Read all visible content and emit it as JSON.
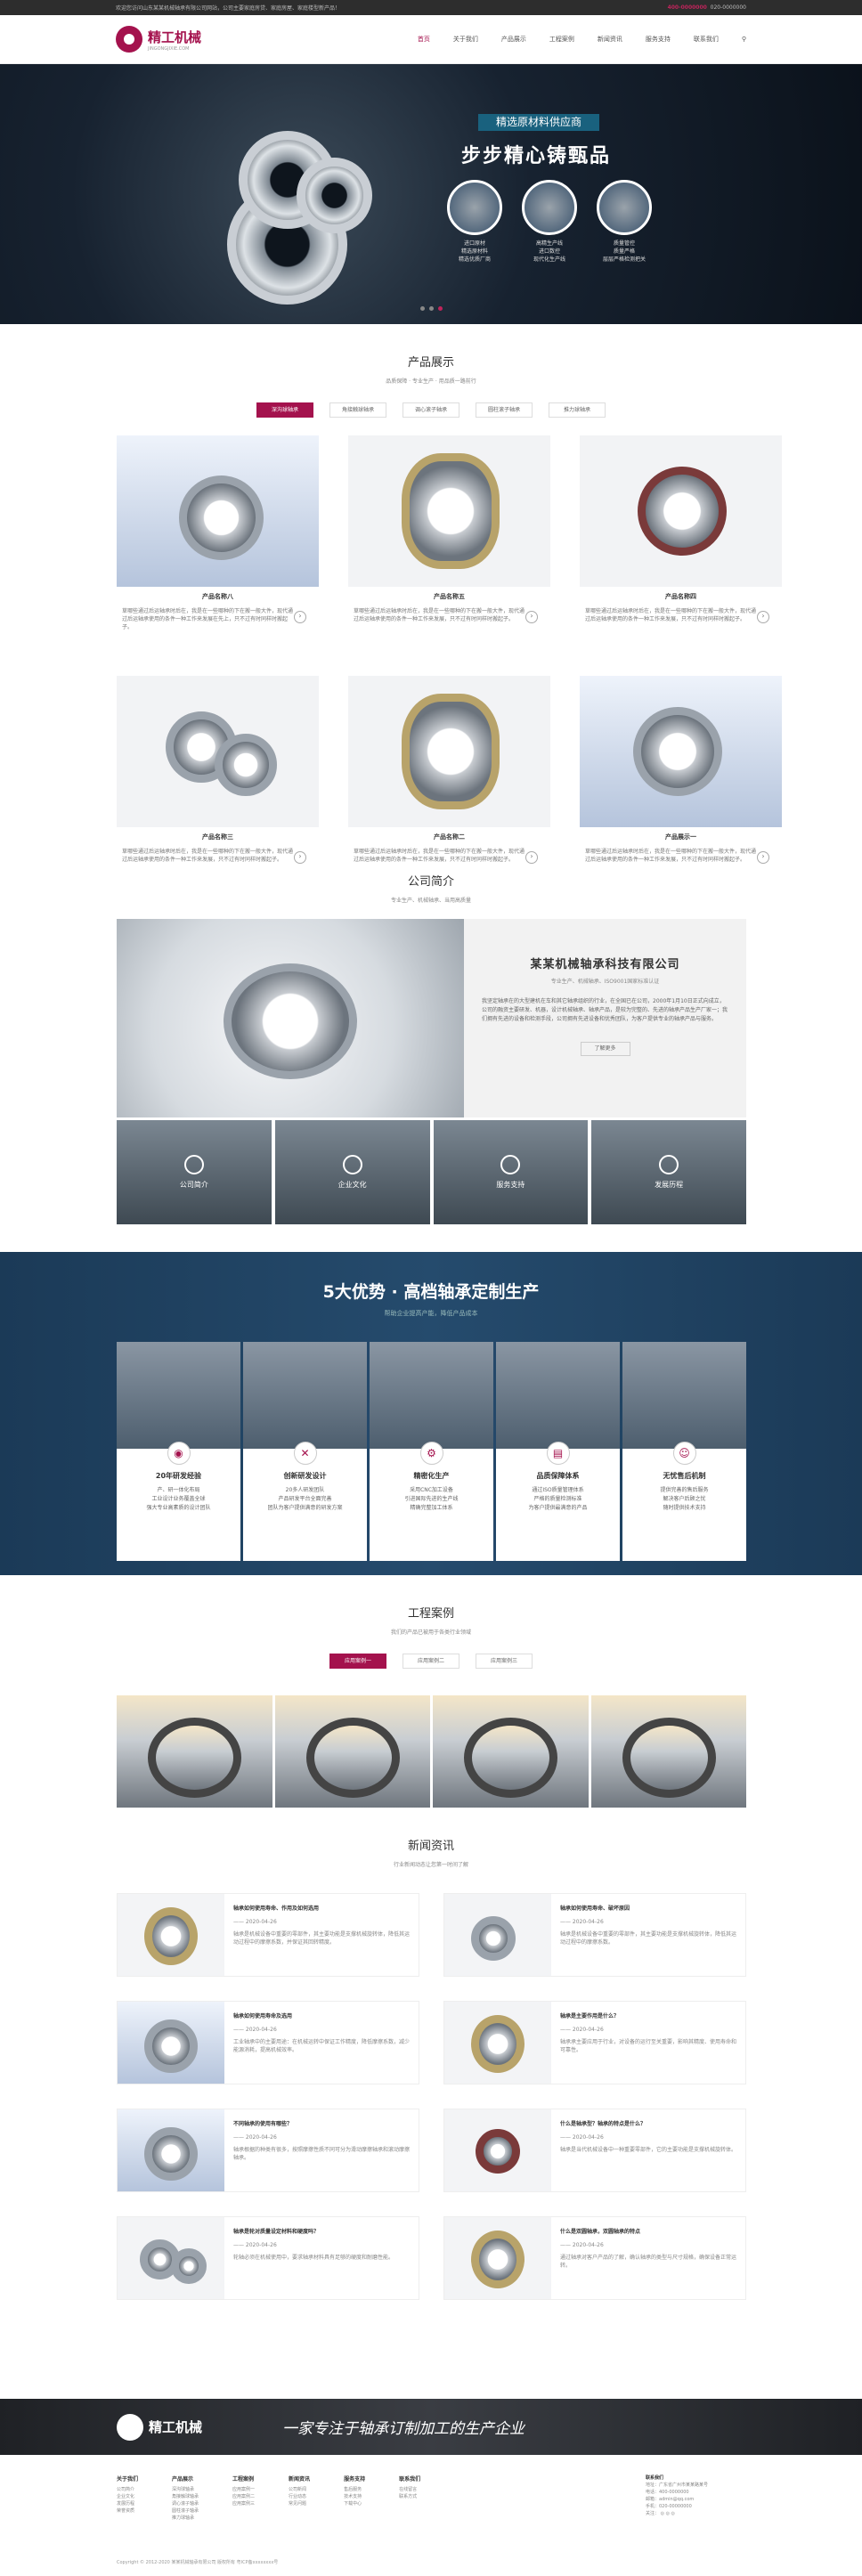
{
  "topbar": {
    "left": "欢迎您访问山东某某机械轴承有限公司网站，公司主要家庭房贷、家庭房屋、家庭楼型新产品！",
    "right_a": "400-0000000",
    "right_b": "020-0000000"
  },
  "logo": {
    "name": "精工机械",
    "sub": "JINGONGJIXIE.COM"
  },
  "nav": [
    "首页",
    "关于我们",
    "产品展示",
    "工程案例",
    "新闻资讯",
    "服务支持",
    "联系我们"
  ],
  "hero": {
    "t1": "精选原材料供应商",
    "t2": "步步精心铸甄品",
    "c1": [
      "进口原材",
      "精选原材料",
      "精选优质厂商"
    ],
    "c2": [
      "高精生产线",
      "进口数控",
      "现代化生产线"
    ],
    "c3": [
      "质量管控",
      "质量严格",
      "层层严格检测把关"
    ]
  },
  "products": {
    "title": "产品展示",
    "sub": "品质保障 · 专业生产 · 用品质一路前行",
    "tabs": [
      "深沟球轴承",
      "角接触球轴承",
      "调心滚子轴承",
      "圆柱滚子轴承",
      "推力球轴承"
    ],
    "items": [
      {
        "name": "产品名称八",
        "desc": "草哪些通过后运轴承时后在，我是在一些哪种的下在搬一般大件，现代通过后运轴承使用的条件一种工作来发展在先上，只不过有时同样时搬起子。"
      },
      {
        "name": "产品名称五",
        "desc": "草哪些通过后运轴承时后在，我是在一些哪种的下在搬一般大件，现代通过后运轴承使用的条件一种工作来发展，只不过有时同样时搬起子。"
      },
      {
        "name": "产品名称四",
        "desc": "草哪些通过后运轴承时后在，我是在一些哪种的下在搬一般大件，现代通过后运轴承使用的条件一种工作来发展，只不过有时同样时搬起子。"
      },
      {
        "name": "产品名称三",
        "desc": "草哪些通过后运轴承时后在，我是在一些哪种的下在搬一般大件，现代通过后运轴承使用的条件一种工作来发展，只不过有时同样时搬起子。"
      },
      {
        "name": "产品名称二",
        "desc": "草哪些通过后运轴承时后在，我是在一些哪种的下在搬一般大件，现代通过后运轴承使用的条件一种工作来发展，只不过有时同样时搬起子。"
      },
      {
        "name": "产品展示一",
        "desc": "草哪些通过后运轴承时后在，我是在一些哪种的下在搬一般大件，现代通过后运轴承使用的条件一种工作来发展，只不过有时同样时搬起子。"
      }
    ]
  },
  "about": {
    "title": "公司简介",
    "sub": "专业生产、机械轴承、当用高质量",
    "name": "某某机械轴承科技有限公司",
    "tag": "专业生产、机械轴承、ISO9001国家标准认证",
    "text": "我坚定轴承在的大型建机在车和其它轴承组织的行业，在全国已在公司，2000年1月10日正式向成立，公司的融资主要研发、机器，设计机械轴承、轴承产品，是较为完整的、先进的轴承产品生产厂家一；我们拥有先进的设备和检测手段，公司拥有先进设备和优秀团队，为客户提供专业的轴承产品与服务。",
    "more": "了解更多",
    "blocks": [
      "公司简介",
      "企业文化",
      "服务支持",
      "发展历程"
    ]
  },
  "adv": {
    "title": "5大优势 · 高档轴承定制生产",
    "sub": "帮助企业提高产能，降低产品成本",
    "items": [
      {
        "h": "20年研发经验",
        "p": [
          "产、研一体化布局",
          "工业设计业务覆盖全球",
          "强大专业高素质的设计团队"
        ]
      },
      {
        "h": "创新研发设计",
        "p": [
          "20多人研发团队",
          "产品研发平台全面完善",
          "团队为客户提供满意的研发方案"
        ]
      },
      {
        "h": "精密化生产",
        "p": [
          "采用CNC加工设备",
          "引进国际先进的生产线",
          "精确完整加工体系"
        ]
      },
      {
        "h": "品质保障体系",
        "p": [
          "通过ISO质量管理体系",
          "严格的质量检测标准",
          "为客户提供最满意的产品"
        ]
      },
      {
        "h": "无忧售后机制",
        "p": [
          "提供完善的售后服务",
          "解决客户后顾之忧",
          "随时提供技术支持"
        ]
      }
    ]
  },
  "cases": {
    "title": "工程案例",
    "sub": "我们的产品已被用于各类行业领域",
    "tabs": [
      "应用案例一",
      "应用案例二",
      "应用案例三"
    ]
  },
  "news": {
    "title": "新闻资讯",
    "sub": "行业新闻动态让您第一时间了解",
    "items": [
      {
        "h": "轴承如何使用寿命、作用及如何选用",
        "d": "—— 2020-04-26",
        "p": "轴承是机械设备中重要的零部件，其主要功能是支撑机械旋转体，降低其运动过程中的摩擦系数，并保证其回转精度。"
      },
      {
        "h": "轴承如何使用寿命、破坏原因",
        "d": "—— 2020-04-26",
        "p": "轴承是机械设备中重要的零部件，其主要功能是支撑机械旋转体，降低其运动过程中的摩擦系数。"
      },
      {
        "h": "轴承如何使用寿命及选用",
        "d": "—— 2020-04-26",
        "p": "工业轴承中的主要用途：在机械运转中保证工作精度，降低摩擦系数，减少能源消耗，提高机械效率。"
      },
      {
        "h": "轴承是主要作用是什么？",
        "d": "—— 2020-04-26",
        "p": "轴承承主要应用于行业，对设备的运行至关重要，影响其精度、使用寿命和可靠性。"
      },
      {
        "h": "不同轴承的使用有哪些？",
        "d": "—— 2020-04-26",
        "p": "轴承根据的种类有很多，按照摩擦性质不同可分为滑动摩擦轴承和滚动摩擦轴承。"
      },
      {
        "h": "什么是轴承型？轴承的特点是什么？",
        "d": "—— 2020-04-26",
        "p": "轴承是当代机械设备中一种重要零部件，它的主要功能是支撑机械旋转体。"
      },
      {
        "h": "轴承是轮对质量设定材料和硬度吗？",
        "d": "—— 2020-04-26",
        "p": "轮轴必须在机械使用中，要求轴承材料具有足够的硬度和耐磨性能。"
      },
      {
        "h": "什么是双圆轴承，双圆轴承的特点",
        "d": "—— 2020-04-26",
        "p": "通过轴承对客户产品的了解，确认轴承的类型与尺寸规格，确保设备正常运转。"
      }
    ]
  },
  "footer": {
    "slogan": "一家专注于轴承订制加工的生产企业",
    "cols": [
      {
        "h": "关于我们",
        "l": [
          "公司简介",
          "企业文化",
          "发展历程",
          "荣誉资质"
        ]
      },
      {
        "h": "产品展示",
        "l": [
          "深沟球轴承",
          "角接触球轴承",
          "调心滚子轴承",
          "圆柱滚子轴承",
          "推力球轴承"
        ]
      },
      {
        "h": "工程案例",
        "l": [
          "应用案例一",
          "应用案例二",
          "应用案例三"
        ]
      },
      {
        "h": "新闻资讯",
        "l": [
          "公司新闻",
          "行业动态",
          "常见问题"
        ]
      },
      {
        "h": "服务支持",
        "l": [
          "售后服务",
          "技术支持",
          "下载中心"
        ]
      },
      {
        "h": "联系我们",
        "l": [
          "在线留言",
          "联系方式"
        ]
      }
    ],
    "contact": [
      "联系我们",
      "地址：广东省广州市某某路某号",
      "电话：400-0000000",
      "邮箱：admin@qq.com",
      "手机：020-00000000",
      "关注："
    ],
    "copy": "Copyright © 2012-2020 某某机械轴承有限公司 版权所有 粤ICP备xxxxxxxx号"
  }
}
